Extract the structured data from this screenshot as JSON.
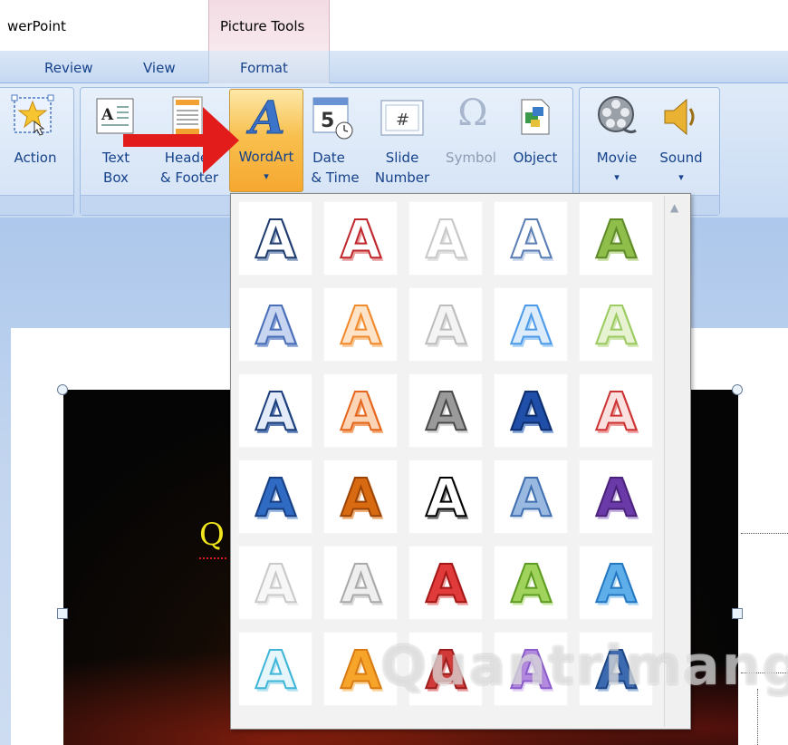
{
  "title_bar": {
    "app_title": "werPoint",
    "context_tab_title": "Picture Tools"
  },
  "tabs": [
    {
      "label": "Review"
    },
    {
      "label": "View"
    },
    {
      "label": "Format"
    }
  ],
  "ribbon": {
    "action": {
      "label": "Action",
      "icon": "action-star-icon"
    },
    "text_box": {
      "line1": "Text",
      "line2": "Box",
      "icon": "text-box-icon"
    },
    "header_footer": {
      "line1": "Header",
      "line2": "& Footer",
      "icon": "header-footer-icon"
    },
    "wordart": {
      "label": "WordArt",
      "arrow": "▾",
      "icon": "wordart-icon"
    },
    "date_time": {
      "line1": "Date",
      "line2": "& Time",
      "icon": "calendar-clock-icon"
    },
    "slide_number": {
      "line1": "Slide",
      "line2": "Number",
      "icon": "slide-number-icon"
    },
    "symbol": {
      "label": "Symbol",
      "glyph": "Ω",
      "icon": "omega-icon"
    },
    "object": {
      "label": "Object",
      "icon": "object-icon"
    },
    "movie": {
      "label": "Movie",
      "arrow": "▾",
      "icon": "film-reel-icon"
    },
    "sound": {
      "label": "Sound",
      "arrow": "▾",
      "icon": "speaker-icon"
    },
    "slide_number_glyph": "#",
    "date_glyph": "5"
  },
  "slide": {
    "partial_text": "Q"
  },
  "gallery": {
    "glyph": "A",
    "scroll_up": "▲",
    "styles": [
      {
        "fill": "#ffffff",
        "stroke": "#1f3b6e",
        "shadow": "#8ea2c2"
      },
      {
        "fill": "#ffffff",
        "stroke": "#c0272d",
        "shadow": "#e8a0a0"
      },
      {
        "fill": "#ffffff",
        "stroke": "#c8c8c8",
        "shadow": "#e0e0e0"
      },
      {
        "fill": "#ffffff",
        "stroke": "#5b7fb5",
        "shadow": "#c9d6ea"
      },
      {
        "fill": "#8fbf4a",
        "stroke": "#5f8a2a",
        "shadow": "#c9e0a5"
      },
      {
        "fill": "#c7d5f0",
        "stroke": "#4a6fb8",
        "shadow": "#8aa3d6"
      },
      {
        "fill": "#fde3c8",
        "stroke": "#f08a2c",
        "shadow": "#f7c999"
      },
      {
        "fill": "#f4f4f4",
        "stroke": "#bdbdbd",
        "shadow": "#dedede"
      },
      {
        "fill": "#dcecfb",
        "stroke": "#4d9be8",
        "shadow": "#a9d1f6"
      },
      {
        "fill": "#e7f2d2",
        "stroke": "#9ccb62",
        "shadow": "#cfe6ae"
      },
      {
        "fill": "#e3ecf8",
        "stroke": "#1c3f7c",
        "shadow": "#5a7bb4"
      },
      {
        "fill": "#fbd5b6",
        "stroke": "#e5661d",
        "shadow": "#f2a56f"
      },
      {
        "fill": "#9a9a9a",
        "stroke": "#4a4a4a",
        "shadow": "#d5d5d5"
      },
      {
        "fill": "#1f4fa8",
        "stroke": "#0d2d6c",
        "shadow": "#7da0d8"
      },
      {
        "fill": "#fbe0e0",
        "stroke": "#cc3333",
        "shadow": "#ee9b9b"
      },
      {
        "fill": "#2f6bc3",
        "stroke": "#173f82",
        "shadow": "#9cbbe6"
      },
      {
        "fill": "#d86a12",
        "stroke": "#9b4405",
        "shadow": "#f0b07a"
      },
      {
        "fill": "#ffffff",
        "stroke": "#000000",
        "shadow": "#777777"
      },
      {
        "fill": "#9ab9e0",
        "stroke": "#3f6fb0",
        "shadow": "#e8eef7"
      },
      {
        "fill": "#6a3aa8",
        "stroke": "#4a2279",
        "shadow": "#c5b2e2"
      },
      {
        "fill": "#f7f7f7",
        "stroke": "#c9c9c9",
        "shadow": "#ececec"
      },
      {
        "fill": "#efefef",
        "stroke": "#a9a9a9",
        "shadow": "#dadada"
      },
      {
        "fill": "#e03a3a",
        "stroke": "#a31717",
        "shadow": "#f1a6a6"
      },
      {
        "fill": "#9fd35b",
        "stroke": "#5e9b22",
        "shadow": "#d2ecb2"
      },
      {
        "fill": "#5eaee9",
        "stroke": "#2477c1",
        "shadow": "#b8dbf6"
      },
      {
        "fill": "#e6f6fb",
        "stroke": "#3fb6d8",
        "shadow": "#b8e4f1"
      },
      {
        "fill": "#f7a52a",
        "stroke": "#d97a12",
        "shadow": "#fbd499"
      },
      {
        "fill": "#d23a3a",
        "stroke": "#9a1e1e",
        "shadow": "#ee9e9e"
      },
      {
        "fill": "#b48ae0",
        "stroke": "#8a5ccc",
        "shadow": "#e3d2f5"
      },
      {
        "fill": "#3c6ab0",
        "stroke": "#1e4684",
        "shadow": "#a7c0e3"
      }
    ]
  },
  "watermark": {
    "text": "Quantrimang"
  }
}
